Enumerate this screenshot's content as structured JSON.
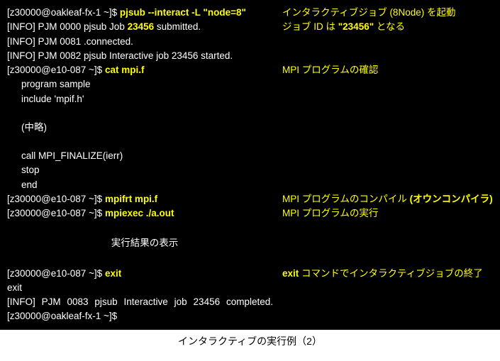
{
  "terminal": {
    "l1_prompt": "[z30000@oakleaf-fx-1 ~]$ ",
    "l1_cmd": "pjsub --interact -L \"node=8\"",
    "l1_note": "インタラクティブジョブ (8Node) を起動",
    "l2a": "[INFO] PJM 0000 pjsub Job ",
    "l2_jobid": "23456",
    "l2b": " submitted.",
    "l2_note_a": "ジョブ ID は ",
    "l2_note_b": "\"23456\"",
    "l2_note_c": " となる",
    "l3": "[INFO] PJM 0081 .connected.",
    "l4": "[INFO] PJM 0082 pjsub Interactive job 23456 started.",
    "l5_prompt": "[z30000@e10-087 ~]$ ",
    "l5_cmd": "cat mpi.f",
    "l5_note": "MPI プログラムの確認",
    "l6": "program sample",
    "l7": "include 'mpif.h'",
    "l8": "(中略)",
    "l9": "call MPI_FINALIZE(ierr)",
    "l10": "stop",
    "l11": "end",
    "l12_prompt": "[z30000@e10-087 ~]$ ",
    "l12_cmd": "mpifrt mpi.f",
    "l12_note_a": "MPI プログラムのコンパイル ",
    "l12_note_b": "(オウンコンパイラ)",
    "l13_prompt": "[z30000@e10-087 ~]$ ",
    "l13_cmd": "mpiexec ./a.out",
    "l13_note": "MPI プログラムの実行",
    "l14": "実行結果の表示",
    "l15_prompt": "[z30000@e10-087 ~]$ ",
    "l15_cmd": "exit",
    "l15_note_a": "exit",
    "l15_note_b": " コマンドでインタラクティブジョブの終了",
    "l16": "exit",
    "l17": "[INFO] PJM 0083 pjsub Interactive job 23456 completed.",
    "l18": "[z30000@oakleaf-fx-1 ~]$"
  },
  "caption": "インタラクティブの実行例（2）"
}
